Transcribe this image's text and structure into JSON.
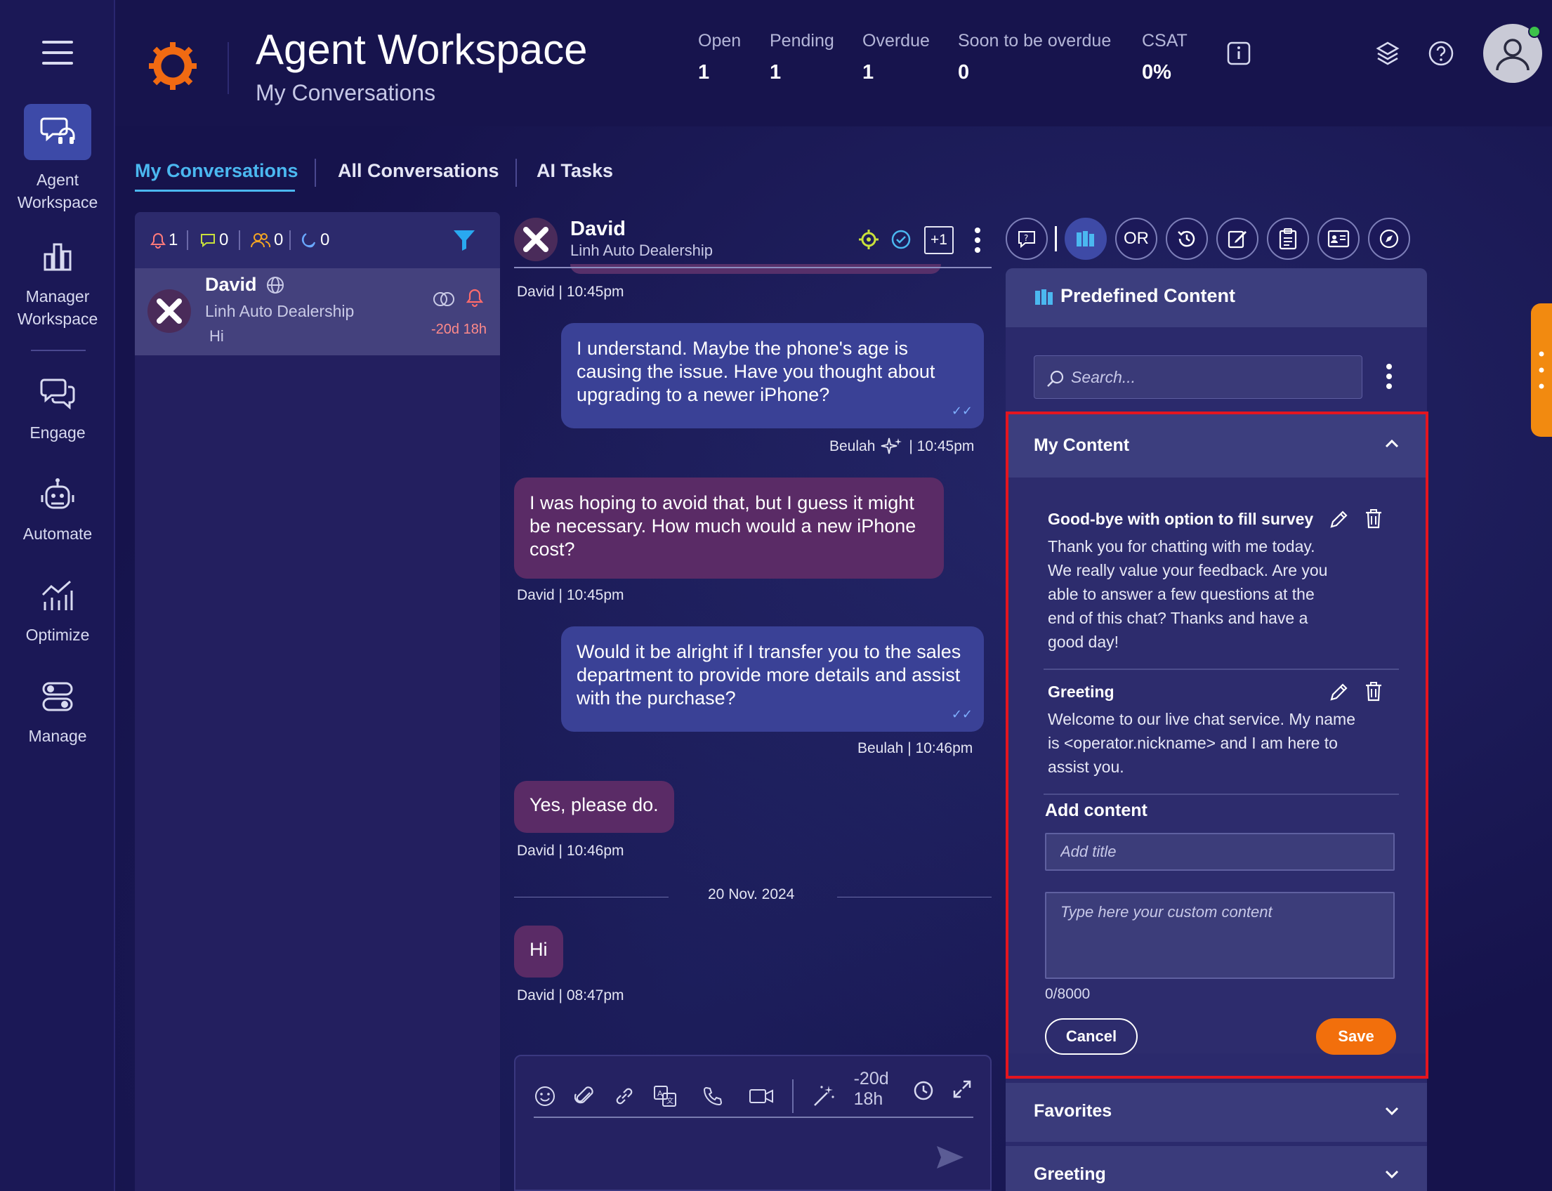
{
  "header": {
    "title": "Agent Workspace",
    "subtitle": "My Conversations",
    "stats": [
      {
        "label": "Open",
        "value": "1"
      },
      {
        "label": "Pending",
        "value": "1"
      },
      {
        "label": "Overdue",
        "value": "1"
      },
      {
        "label": "Soon to be overdue",
        "value": "0"
      },
      {
        "label": "CSAT",
        "value": "0%"
      }
    ]
  },
  "sidebar": {
    "items": [
      {
        "label": "Agent\nWorkspace",
        "icon": "headset-chat-icon",
        "active": true
      },
      {
        "label": "Manager\nWorkspace",
        "icon": "bar-chart-icon"
      },
      {
        "label": "Engage",
        "icon": "chat-bubbles-icon"
      },
      {
        "label": "Automate",
        "icon": "robot-icon"
      },
      {
        "label": "Optimize",
        "icon": "trend-chart-icon"
      },
      {
        "label": "Manage",
        "icon": "toggles-icon"
      }
    ]
  },
  "tabs": [
    {
      "label": "My Conversations",
      "active": true
    },
    {
      "label": "All Conversations"
    },
    {
      "label": "AI Tasks"
    }
  ],
  "conv_filter": {
    "alerts": "1",
    "messages": "0",
    "users": "0",
    "away": "0"
  },
  "conversation": {
    "name": "David",
    "company": "Linh Auto Dealership",
    "preview": "Hi",
    "timer": "-20d 18h"
  },
  "chat": {
    "name": "David",
    "company": "Linh Auto Dealership",
    "plus": "+1",
    "messages": [
      {
        "meta": "David  |  10:45pm"
      },
      {
        "text": "I understand. Maybe the phone's age is causing the issue. Have you thought about upgrading to a newer iPhone?",
        "meta_name": "Beulah",
        "meta_time": "|  10:45pm"
      },
      {
        "text": "I was hoping to avoid that, but I guess it might be necessary. How much would a new iPhone cost?",
        "meta": "David  |  10:45pm"
      },
      {
        "text": "Would it be alright if I transfer you to the sales department to provide more details and assist with the purchase?",
        "meta": "Beulah  |  10:46pm"
      },
      {
        "text": "Yes, please do.",
        "meta": "David  |  10:46pm"
      },
      {
        "date": "20 Nov. 2024"
      },
      {
        "text": "Hi",
        "meta": "David  |  08:47pm"
      }
    ],
    "composer_timer": "-20d 18h"
  },
  "panel": {
    "title": "Predefined Content",
    "search_placeholder": "Search...",
    "my_content": {
      "title": "My Content",
      "items": [
        {
          "title": "Good-bye with option to fill survey",
          "body": "Thank you for chatting with me today. We really value your feedback. Are you able to answer a few questions at the end of this chat? Thanks and have a good day!"
        },
        {
          "title": "Greeting",
          "body": "Welcome to our live chat service. My name is <operator.nickname> and I am here to assist you."
        }
      ],
      "add_content_label": "Add content",
      "title_placeholder": "Add title",
      "content_placeholder": "Type here your custom content",
      "counter": "0/8000",
      "cancel_label": "Cancel",
      "save_label": "Save"
    },
    "favorites": "Favorites",
    "greeting": "Greeting",
    "toolbar_or": "OR"
  },
  "colors": {
    "accent": "#4bb8f0",
    "save": "#f26f0c",
    "highlight": "#e4151f",
    "agent_bubble": "#3a4196",
    "customer_bubble": "#5a2b66"
  }
}
